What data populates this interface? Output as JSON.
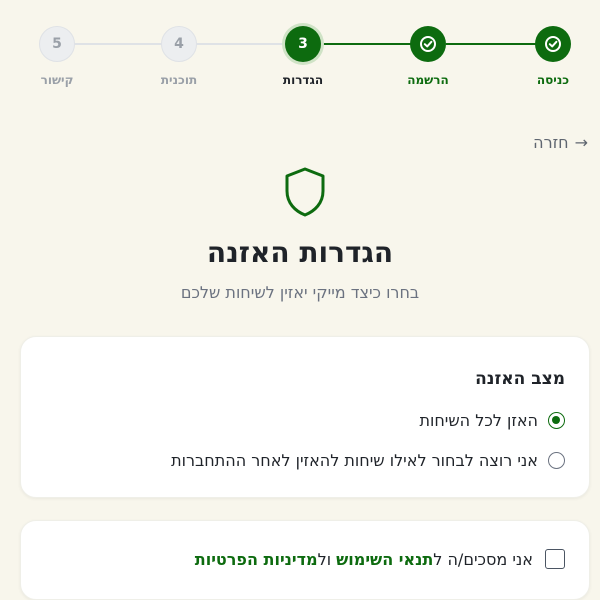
{
  "stepper": {
    "steps": [
      {
        "number": "1",
        "label": "כניסה",
        "status": "done"
      },
      {
        "number": "2",
        "label": "הרשמה",
        "status": "done"
      },
      {
        "number": "3",
        "label": "הגדרות",
        "status": "current"
      },
      {
        "number": "4",
        "label": "תוכנית",
        "status": "todo"
      },
      {
        "number": "5",
        "label": "קישור",
        "status": "todo"
      }
    ]
  },
  "back": {
    "label": "חזרה",
    "arrow": "→"
  },
  "header": {
    "title": "הגדרות האזנה",
    "subtitle": "בחרו כיצד מייקי יאזין לשיחות שלכם"
  },
  "listen_mode": {
    "title": "מצב האזנה",
    "options": [
      {
        "label": "האזן לכל השיחות",
        "checked": true
      },
      {
        "label": "אני רוצה לבחור לאילו שיחות להאזין לאחר ההתחברות",
        "checked": false
      }
    ]
  },
  "consent": {
    "prefix": "אני מסכים/ה ל",
    "terms_link": "תנאי השימוש",
    "and": "ול",
    "privacy_link": "מדיניות הפרטיות",
    "checked": false
  },
  "colors": {
    "accent": "#0d6b0f",
    "background": "#f8f6ec"
  }
}
